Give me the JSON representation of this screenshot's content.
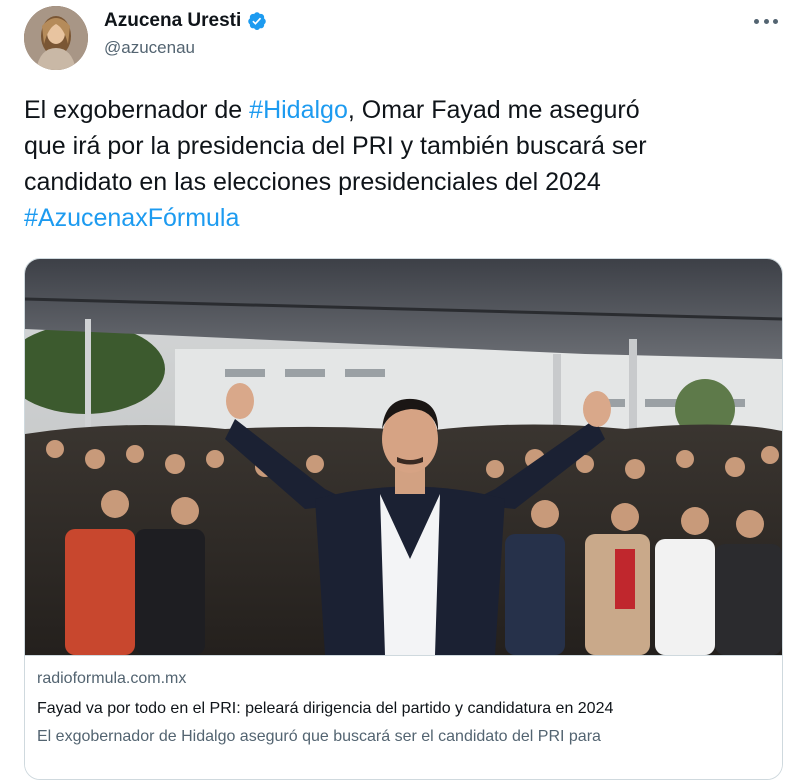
{
  "author": {
    "display_name": "Azucena Uresti",
    "handle": "@azucenau",
    "verified_icon": "verified-badge-icon",
    "verified_color": "#1d9bf0"
  },
  "more_icon": "more-options-icon",
  "tweet": {
    "line1_pre": "El exgobernador de ",
    "hashtag1": "#Hidalgo",
    "line1_post": ", Omar Fayad me aseguró",
    "line2": "que irá por la presidencia del PRI y también buscará ser",
    "line3": "candidato en las elecciones presidenciales del 2024",
    "hashtag2": "#AzucenaxFórmula",
    "link_color": "#1d9bf0"
  },
  "card": {
    "image_alt": "Omar Fayad con los pulgares arriba frente a una multitud bajo una carpa",
    "domain": "radioformula.com.mx",
    "title": "Fayad va por todo en el PRI: peleará dirigencia del partido y candidatura en 2024",
    "description": "El exgobernador de Hidalgo aseguró que buscará ser el candidato del PRI para"
  }
}
